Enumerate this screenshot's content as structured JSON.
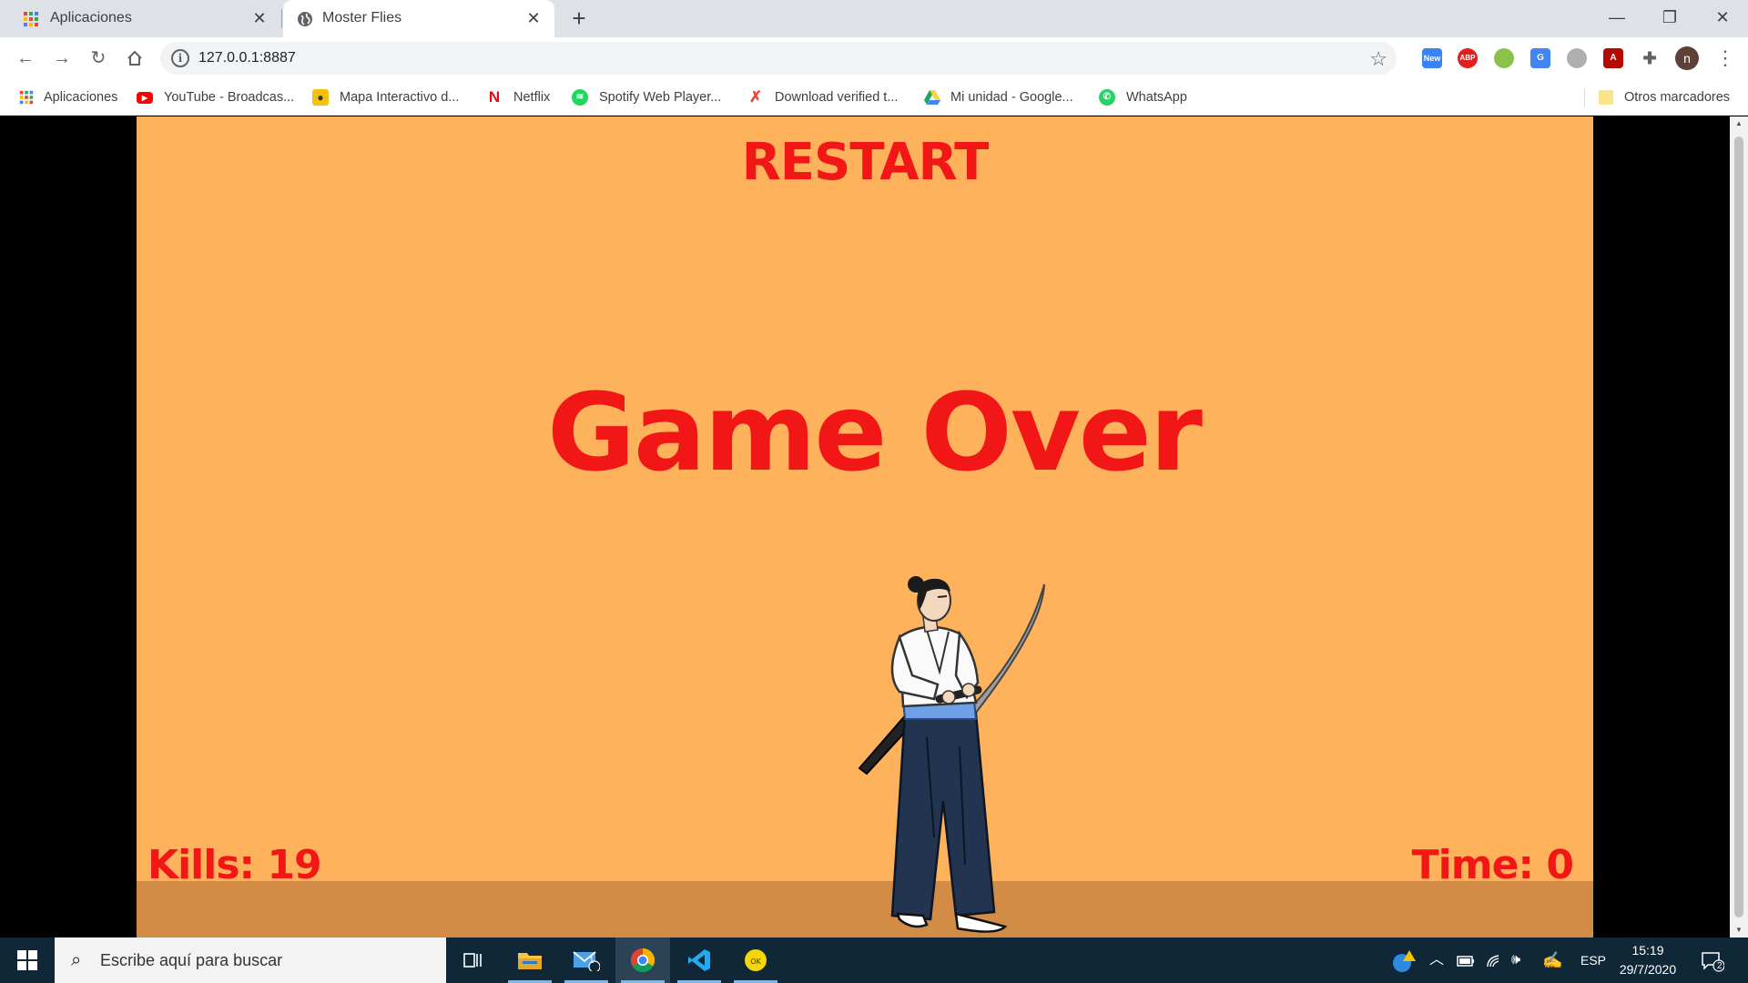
{
  "browser": {
    "tabs": [
      {
        "title": "Aplicaciones",
        "active": false,
        "icon": "apps-grid-icon"
      },
      {
        "title": "Moster Flies",
        "active": true,
        "icon": "globe-icon"
      }
    ],
    "url": "127.0.0.1:8887",
    "bookmarks": [
      {
        "label": "Aplicaciones",
        "icon": "apps-grid-icon",
        "color": "#e94235"
      },
      {
        "label": "YouTube - Broadcas...",
        "icon": "youtube-icon",
        "color": "#ff0000"
      },
      {
        "label": "Mapa Interactivo d...",
        "icon": "map-pin-icon",
        "color": "#f4c20d"
      },
      {
        "label": "Netflix",
        "icon": "netflix-icon",
        "color": "#e50914"
      },
      {
        "label": "Spotify Web Player...",
        "icon": "spotify-icon",
        "color": "#1ed760"
      },
      {
        "label": "Download verified t...",
        "icon": "x-icon",
        "color": "#e8453c"
      },
      {
        "label": "Mi unidad - Google...",
        "icon": "drive-icon",
        "color": "#1fa463"
      },
      {
        "label": "WhatsApp",
        "icon": "whatsapp-icon",
        "color": "#25d366"
      }
    ],
    "other_bookmarks": "Otros marcadores",
    "extensions": [
      {
        "name": "new-extension-icon",
        "badge": "New"
      },
      {
        "name": "adblock-icon",
        "label": "ABP"
      },
      {
        "name": "green-extension-icon"
      },
      {
        "name": "translate-icon"
      },
      {
        "name": "compass-icon"
      },
      {
        "name": "acrobat-icon"
      },
      {
        "name": "puzzle-icon"
      }
    ],
    "profile_initial": "n"
  },
  "game": {
    "restart_label": "RESTART",
    "game_over_label": "Game Over",
    "kills_label": "Kills: 19",
    "kills": 19,
    "time_label": "Time: 0",
    "time": 0,
    "colors": {
      "background": "#ffb25c",
      "ground": "#d38c45",
      "text": "#f21717"
    },
    "character": "samurai"
  },
  "taskbar": {
    "search_placeholder": "Escribe aquí para buscar",
    "apps": [
      "task-view-icon",
      "file-explorer-icon",
      "mail-icon",
      "chrome-icon",
      "vscode-icon",
      "ok-app-icon"
    ],
    "mail_badge": "1",
    "language": "ESP",
    "time": "15:19",
    "date": "29/7/2020",
    "notifications": "2"
  }
}
